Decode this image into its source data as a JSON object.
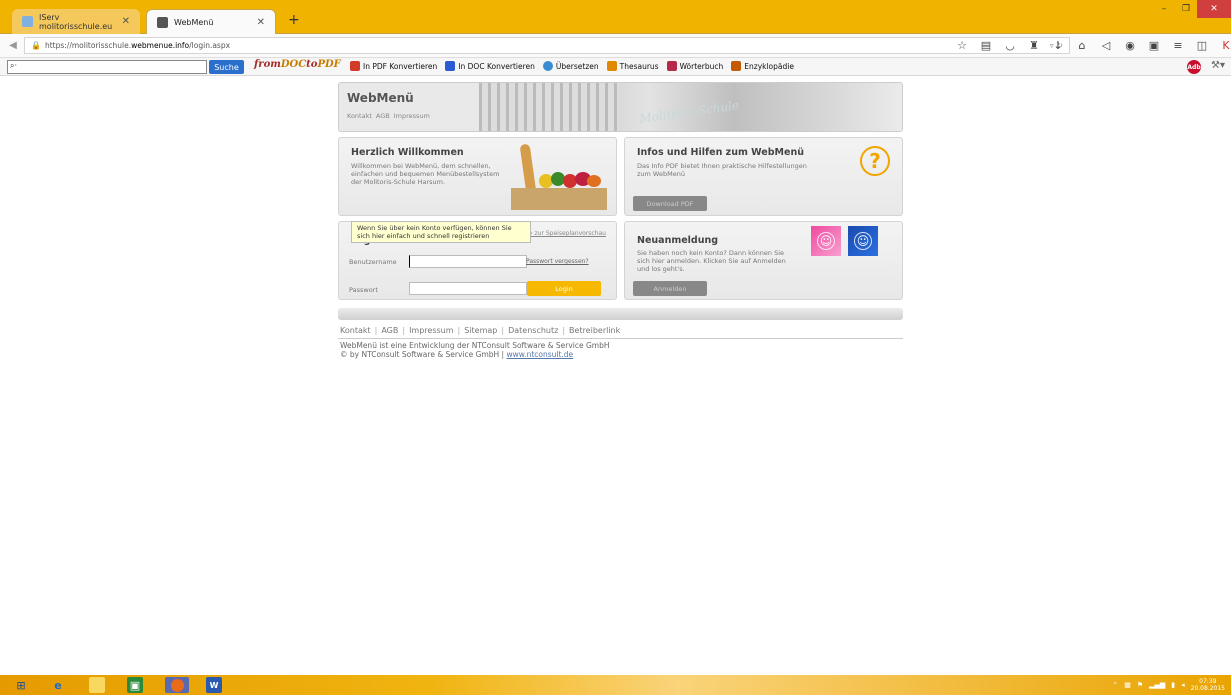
{
  "browser": {
    "tabs": [
      {
        "label": "IServ molitorisschule.eu",
        "active": false
      },
      {
        "label": "WebMenü",
        "active": true
      }
    ],
    "url_prefix": "https://molitorisschule.",
    "url_host": "webmenue.info",
    "url_path": "/login.aspx",
    "search_placeholder": "",
    "search_button": "Suche",
    "brand": {
      "part1": "from",
      "part2": "DOC",
      "part3": "to",
      "part4": "PDF"
    },
    "toolbar_links": [
      {
        "label": "In PDF Konvertieren",
        "color": "#d23a2a"
      },
      {
        "label": "In DOC Konvertieren",
        "color": "#2a5bd2"
      },
      {
        "label": "Übersetzen",
        "color": "#3a8cd2"
      },
      {
        "label": "Thesaurus",
        "color": "#e08800"
      },
      {
        "label": "Wörterbuch",
        "color": "#b52a4a"
      },
      {
        "label": "Enzyklopädie",
        "color": "#c45a00"
      }
    ]
  },
  "header": {
    "logo": "WebMenü",
    "links": [
      "Kontakt",
      "AGB",
      "Impressum"
    ],
    "sign": "Molitoris-Schule"
  },
  "welcome": {
    "title": "Herzlich Willkommen",
    "text": "Willkommen bei WebMenü, dem schnellen, einfachen und bequemen Menübestellsystem der Molitoris-Schule Harsum."
  },
  "info": {
    "title": "Infos und Hilfen zum WebMenü",
    "text": "Das Info PDF bietet Ihnen praktische Hilfestellungen zum WebMenü",
    "button": "Download PDF"
  },
  "login": {
    "title": "Login",
    "preview_link": "» zur Speiseplanvorschau",
    "username_label": "Benutzername",
    "password_label": "Passwort",
    "forgot_link": "Passwort vergessen?",
    "button": "Login"
  },
  "register": {
    "title": "Neuanmeldung",
    "text": "Sie haben noch kein Konto? Dann können Sie sich hier anmelden. Klicken Sie auf Anmelden und los geht's.",
    "button": "Anmelden",
    "tooltip": "Wenn Sie über kein Konto verfügen, können Sie sich hier einfach und schnell registrieren"
  },
  "footer": {
    "links": [
      "Kontakt",
      "AGB",
      "Impressum",
      "Sitemap",
      "Datenschutz",
      "Betreiberlink"
    ],
    "line1": "WebMenü ist eine Entwicklung der NTConsult Software & Service GmbH",
    "line2_prefix": "© by NTConsult Software & Service GmbH |",
    "line2_link": "www.ntconsult.de"
  },
  "taskbar": {
    "time": "07:39",
    "date": "20.08.2015"
  }
}
